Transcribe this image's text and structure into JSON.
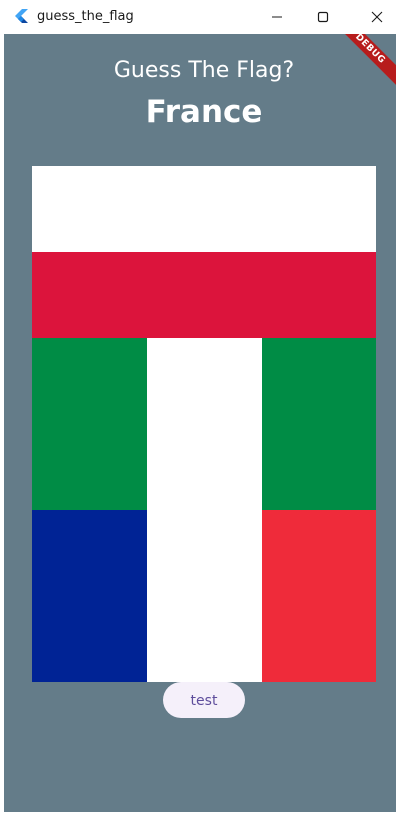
{
  "window": {
    "title": "guess_the_flag",
    "buttons": [
      "minimize-icon",
      "maximize-icon",
      "close-icon"
    ]
  },
  "app": {
    "debug_banner": "DEBUG",
    "question": "Guess The Flag?",
    "country": "France",
    "background_color": "#647c89"
  },
  "flags": [
    {
      "name": "poland-flag",
      "layout": "horizontal",
      "colors": [
        "#ffffff",
        "#dc143c"
      ]
    },
    {
      "name": "italy-flag",
      "layout": "vertical",
      "colors": [
        "#008c45",
        "#ffffff",
        "#008c45"
      ]
    },
    {
      "name": "france-flag",
      "layout": "vertical",
      "colors": [
        "#002395",
        "#ffffff",
        "#ef2b3a"
      ]
    }
  ],
  "actions": {
    "test_label": "test"
  }
}
